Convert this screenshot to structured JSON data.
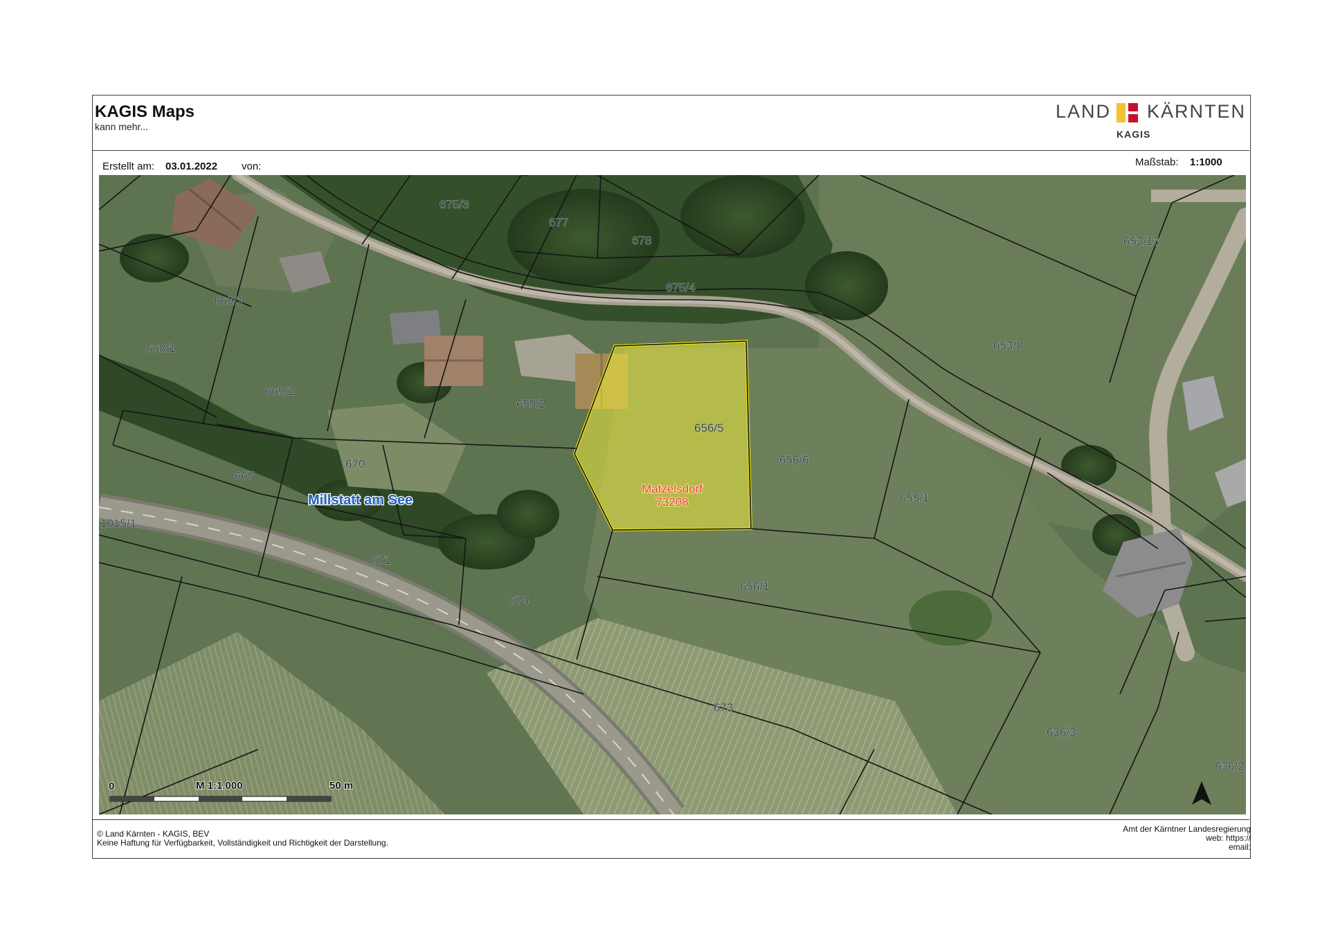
{
  "header": {
    "title": "KAGIS Maps",
    "subtitle": "kann mehr...",
    "logo": {
      "word_left": "LAND",
      "word_right": "KÄRNTEN",
      "sub": "KAGIS",
      "colors": {
        "yellow": "#f2c230",
        "red": "#c8102e"
      }
    }
  },
  "meta": {
    "created_label": "Erstellt am:",
    "created_value": "03.01.2022",
    "from_label": "von:",
    "scale_label": "Maßstab:",
    "scale_value": "1:1000"
  },
  "map": {
    "place_name": "Millstatt am See",
    "selected_parcel": {
      "number": "656/5",
      "cadastral_community": "Matzelsdorf",
      "cadastral_code": "73208",
      "highlight_color": "#f0ec3c"
    },
    "parcels": {
      "p675_3": "675/3",
      "p677": "677",
      "p678": "678",
      "p653_13": "653/13",
      "p669_1": "669/1",
      "p675_4": "675/4",
      "p668_1": "668/1",
      "p653_8": "653/8",
      "p669_2": "669/2",
      "p655_2": "655/2",
      "p656_6": "656/6",
      "p670": "670",
      "p667": "667",
      "p655_1": "655/1",
      "p1015_1": "1015/1",
      "p671": "671",
      "p656_1": "656/1",
      "p674": "674",
      "p673": "673",
      "p636_3": "636/3",
      "p636_2": "636/2"
    },
    "scalebar": {
      "start": "0",
      "ratio": "M 1:1.000",
      "end": "50 m"
    },
    "north_arrow": "north-arrow-icon"
  },
  "footer": {
    "copyright": "© Land Kärnten - KAGIS, BEV",
    "disclaimer": "Keine Haftung für Verfügbarkeit, Vollständigkeit und Richtigkeit der Darstellung.",
    "agency": "Amt der Kärntner Landesregierung",
    "web_label": "web: https://",
    "email_label": "email:"
  }
}
